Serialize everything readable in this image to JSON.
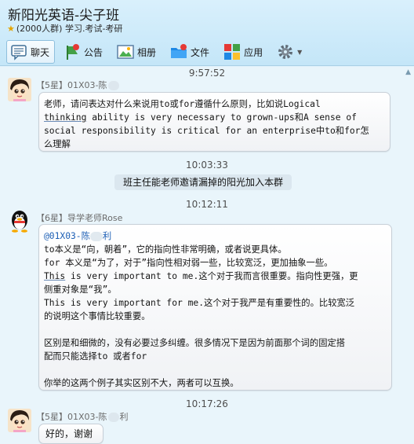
{
  "header": {
    "title": "新阳光英语-尖子班",
    "member_count": "(2000人群)",
    "tags": "学习.考试-考研"
  },
  "toolbar": {
    "chat": "聊天",
    "notice": "公告",
    "album": "相册",
    "files": "文件",
    "apps": "应用",
    "settings_icon": "gear-icon"
  },
  "messages": {
    "t1": "9:57:52",
    "m1_level": "【5星】",
    "m1_name_a": "01X03-陈",
    "m1_lines": [
      "老师，请问表达对什么来说用to或for遵循什么原则，比如说Logical",
      "thinking ability is very necessary to grown-ups和A sense of",
      "social responsibility is critical for an enterprise中to和for怎",
      "么理解"
    ],
    "t2": "10:03:33",
    "system_notice": "班主任能老师邀请漏掉的阳光加入本群",
    "t3": "10:12:11",
    "m2_level": "【6星】",
    "m2_name": "导学老师Rose",
    "m2_mention": "@01X03-陈",
    "m2_mention_tail": "利",
    "m2_lines": [
      "to本义是“向，朝着”，它的指向性非常明确，或者说更具体。",
      "for 本义是“为了，对于”指向性相对弱一些，比较宽泛，更加抽象一些。",
      "This is very important to me.这个对于我而言很重要。指向性更强，更",
      "侧重对象是“我”。",
      "This is very important for me.这个对于我严是有重要性的。比较宽泛",
      "的说明这个事情比较重要。",
      "",
      "区别是和细微的，没有必要过多纠缠。很多情况下是因为前面那个词的固定搭",
      "配而只能选择to 或者for",
      "",
      "你举的这两个例子其实区别不大，两者可以互换。"
    ],
    "t4": "10:17:26",
    "m3_level": "【5星】",
    "m3_name_a": "01X03-陈",
    "m3_name_b": "利",
    "m3_text": "好的，谢谢"
  },
  "colors": {
    "header_bg": "#cbe9f9",
    "chat_bg": "#e9f5fb",
    "mention": "#1d5fb5"
  }
}
